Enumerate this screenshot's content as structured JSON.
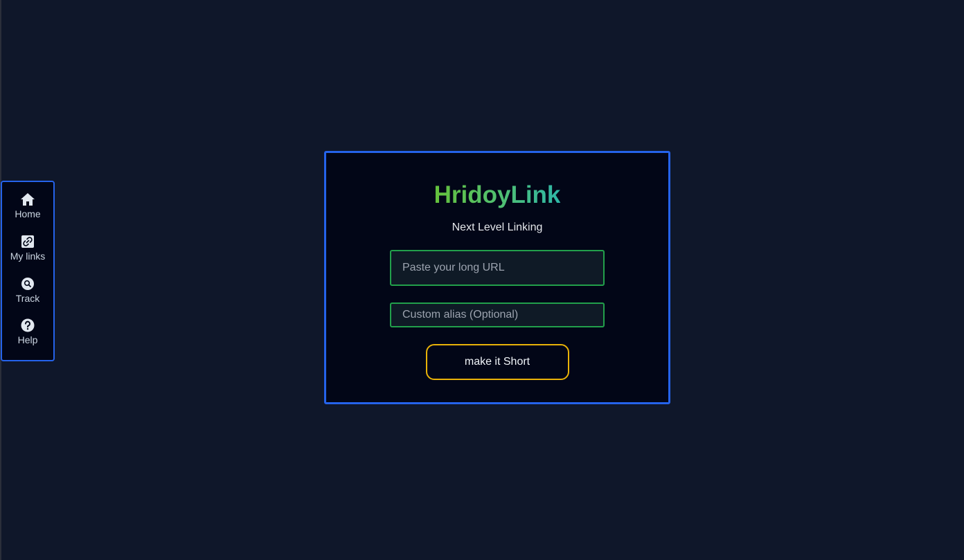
{
  "nav": {
    "items": [
      {
        "label": "Home",
        "icon": "home-icon"
      },
      {
        "label": "My links",
        "icon": "link-icon"
      },
      {
        "label": "Track",
        "icon": "search-icon"
      },
      {
        "label": "Help",
        "icon": "help-icon"
      }
    ]
  },
  "card": {
    "brand": "HridoyLink",
    "tagline": "Next Level Linking",
    "url_placeholder": "Paste your long URL",
    "alias_placeholder": "Custom alias (Optional)",
    "submit_label": "make it Short"
  },
  "colors": {
    "background": "#0f172a",
    "card_background": "#020617",
    "border_accent": "#2563eb",
    "input_border": "#22a04b",
    "button_border": "#eab308",
    "brand_gradient_start": "#65c13c",
    "brand_gradient_end": "#2eb7a8"
  }
}
